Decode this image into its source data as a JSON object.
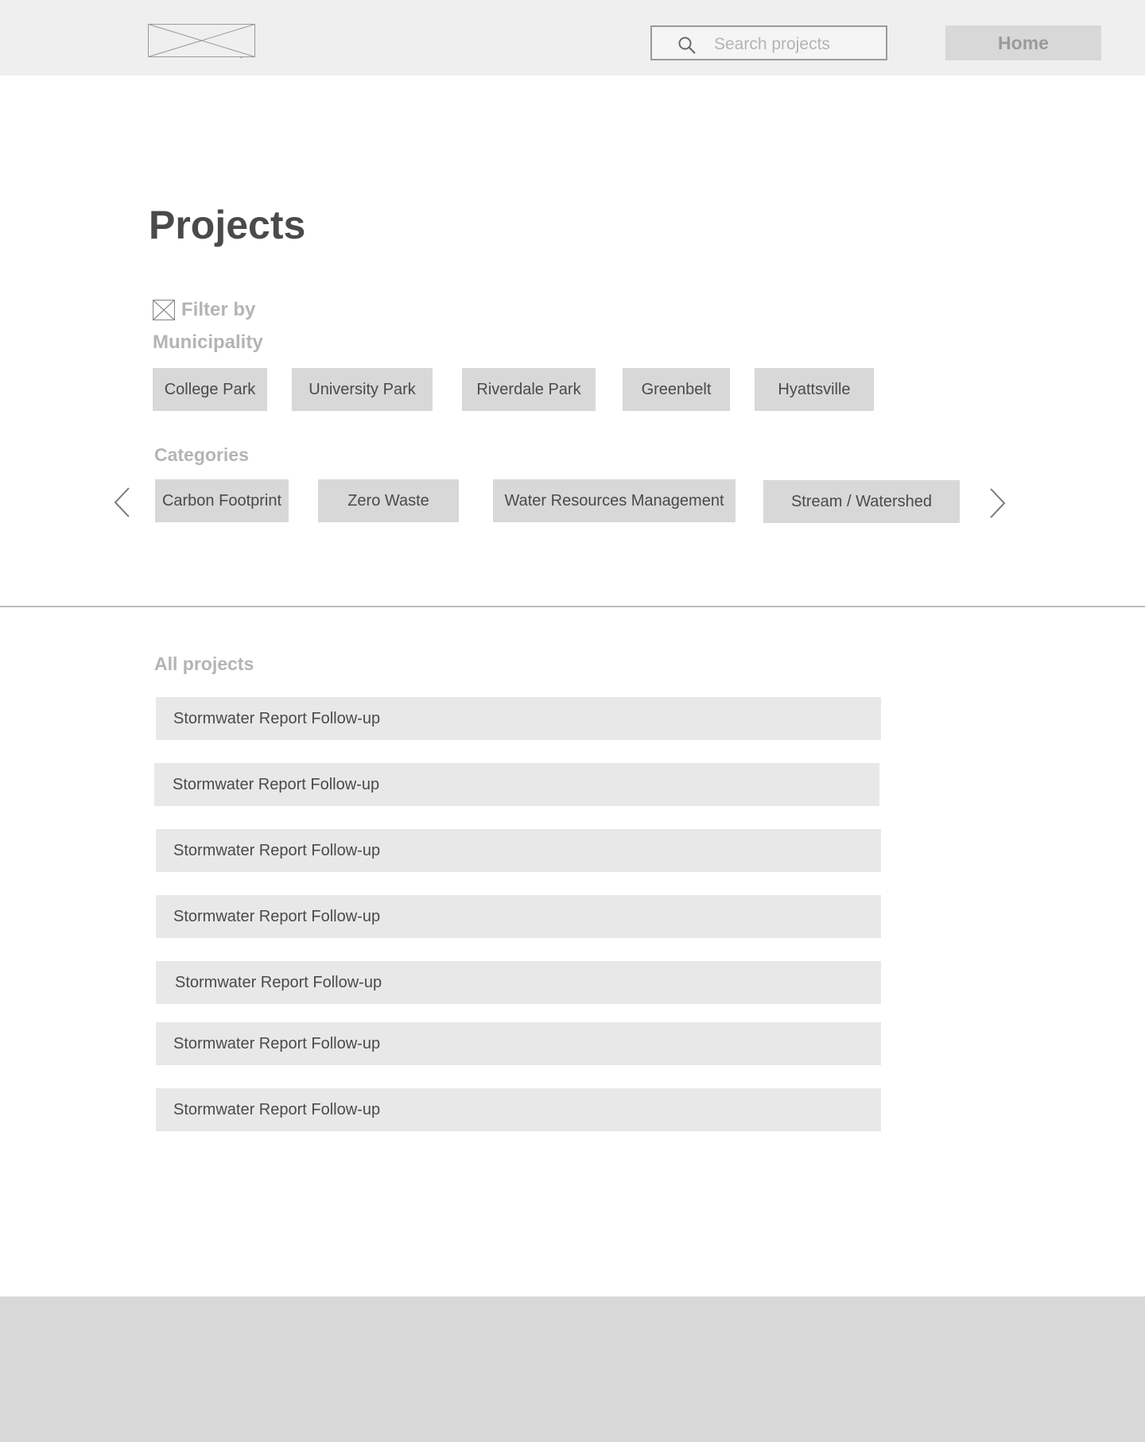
{
  "header": {
    "search_placeholder": "Search projects",
    "home_label": "Home"
  },
  "page": {
    "title": "Projects"
  },
  "filters": {
    "filter_by_label": "Filter by",
    "municipality_label": "Municipality",
    "municipalities": [
      "College Park",
      "University Park",
      "Riverdale Park",
      "Greenbelt",
      "Hyattsville"
    ],
    "categories_label": "Categories",
    "categories": [
      "Carbon Footprint",
      "Zero Waste",
      "Water Resources Management",
      "Stream / Watershed"
    ]
  },
  "projects": {
    "label": "All projects",
    "items": [
      "Stormwater Report Follow-up",
      "Stormwater Report Follow-up",
      "Stormwater Report Follow-up",
      "Stormwater Report Follow-up",
      "Stormwater Report Follow-up",
      "Stormwater Report Follow-up",
      "Stormwater Report Follow-up"
    ]
  },
  "icons": {
    "logo": "image-placeholder-icon",
    "search": "search-icon",
    "filter": "image-placeholder-icon",
    "prev": "chevron-left-icon",
    "next": "chevron-right-icon"
  },
  "colors": {
    "header_bg": "#efefef",
    "chip_bg": "#d8d8d8",
    "row_bg": "#e8e8e8",
    "muted_text": "#b4b4b4",
    "dark_text": "#4a4a4a",
    "footer_bg": "#d8d8d8"
  }
}
